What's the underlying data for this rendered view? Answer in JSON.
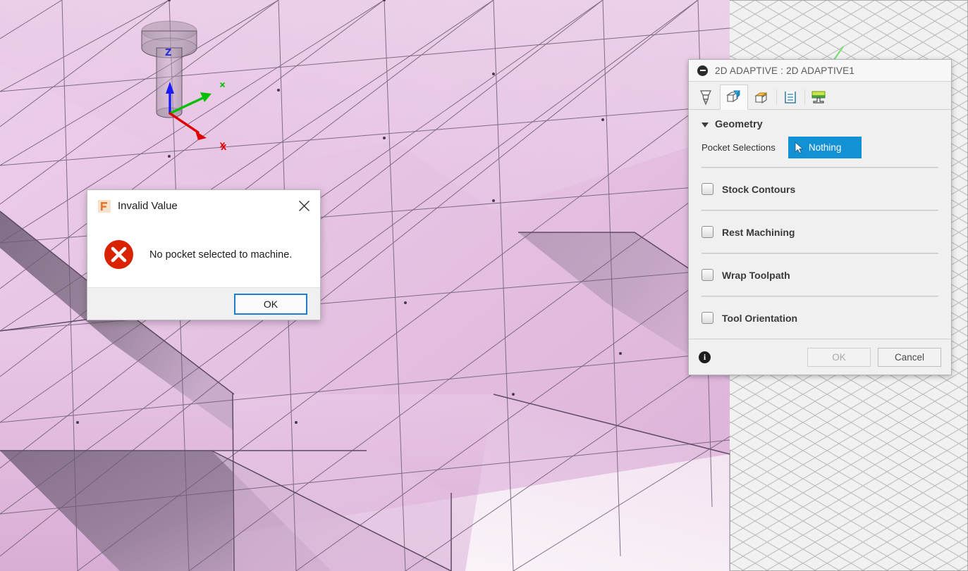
{
  "viewport": {
    "name": "3d-model-viewport",
    "model_color": "#e7c3e4",
    "model_shadow_color": "#6e5a70",
    "edge_color": "#6b5a70",
    "grid_color": "#b9b9b9",
    "background_color": "#fdfdfd",
    "triad": {
      "x_axis_label": "X",
      "x_axis_color": "#e00000",
      "y_axis_label": "",
      "y_axis_color": "#00c000",
      "z_axis_label": "Z",
      "z_axis_color": "#1a1aff"
    },
    "tool_name": "end-mill-tool"
  },
  "panel": {
    "title": "2D ADAPTIVE : 2D ADAPTIVE1",
    "collapse_icon": "minimize-icon",
    "tabs": [
      {
        "name": "tool",
        "icon": "end-mill-icon",
        "active": false
      },
      {
        "name": "geometry",
        "icon": "geometry-cube-icon",
        "active": true
      },
      {
        "name": "heights",
        "icon": "heights-box-icon",
        "active": false
      },
      {
        "name": "passes",
        "icon": "passes-icon",
        "active": false
      },
      {
        "name": "linking",
        "icon": "linking-icon",
        "active": false
      }
    ],
    "group": {
      "title": "Geometry",
      "caret_icon": "caret-down-icon"
    },
    "pocket_selections": {
      "label": "Pocket Selections",
      "button_label": "Nothing",
      "button_icon": "select-cursor-icon",
      "button_color": "#1291d4"
    },
    "options": [
      {
        "label": "Stock Contours",
        "checked": false
      },
      {
        "label": "Rest Machining",
        "checked": false
      },
      {
        "label": "Wrap Toolpath",
        "checked": false
      },
      {
        "label": "Tool Orientation",
        "checked": false
      }
    ],
    "footer": {
      "info_icon": "info-icon",
      "info_glyph": "i",
      "ok_label": "OK",
      "ok_disabled": true,
      "cancel_label": "Cancel"
    }
  },
  "error_dialog": {
    "app_icon": "fusion-f-logo-icon",
    "title": "Invalid Value",
    "close_icon": "close-icon",
    "error_icon": "error-x-icon",
    "message": "No pocket selected to machine.",
    "ok_label": "OK",
    "accent_color": "#1a7fd4",
    "error_color": "#d62200"
  }
}
